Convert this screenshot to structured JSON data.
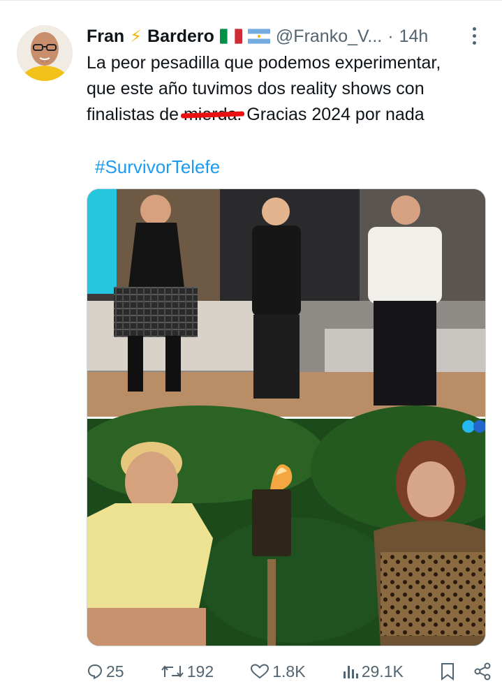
{
  "tweet": {
    "author": {
      "first_name": "Fran",
      "last_name": "Bardero",
      "handle": "@Franko_V...",
      "separator": "·",
      "time": "14h"
    },
    "text_lines": [
      "La peor pesadilla que podemos experimentar,",
      "que este año tuvimos dos reality shows con"
    ],
    "line3_prefix": "finalistas de ",
    "censored_word": "mierda.",
    "line3_suffix": " Gracias 2024 por nada",
    "hashtag": "#SurvivorTelefe"
  },
  "actions": {
    "replies": "25",
    "reposts": "192",
    "likes": "1.8K",
    "views": "29.1K"
  },
  "icons": {
    "bolt": "lightning-emoji",
    "flag_italy": "italy-flag",
    "flag_argentina": "argentina-flag",
    "more": "more-vertical-icon",
    "reply": "reply-icon",
    "repost": "repost-icon",
    "like": "heart-icon",
    "views": "views-icon",
    "bookmark": "bookmark-icon",
    "share": "share-icon"
  },
  "colors": {
    "accent": "#1d9bf0",
    "muted": "#536471",
    "strike": "#e81010"
  }
}
